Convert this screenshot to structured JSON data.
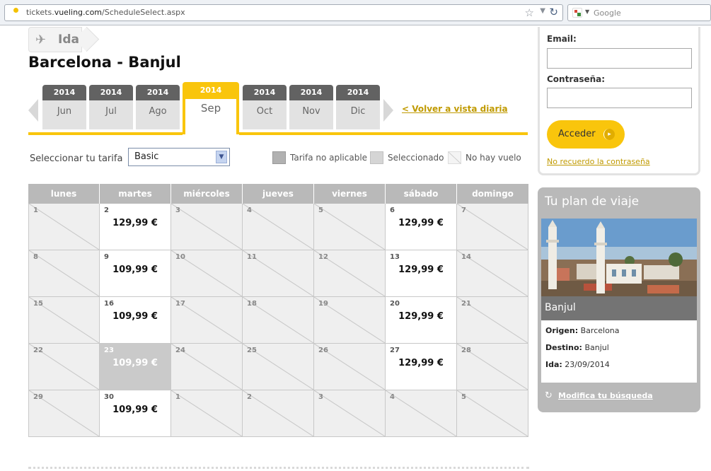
{
  "browser": {
    "url_prefix": "tickets.",
    "url_domain": "vueling.com",
    "url_path": "/ScheduleSelect.aspx",
    "search_placeholder": "Google"
  },
  "header": {
    "tab_label": "Ida",
    "route": "Barcelona - Banjul"
  },
  "months": [
    {
      "year": "2014",
      "label": "Jun"
    },
    {
      "year": "2014",
      "label": "Jul"
    },
    {
      "year": "2014",
      "label": "Ago"
    },
    {
      "year": "2014",
      "label": "Sep",
      "active": true
    },
    {
      "year": "2014",
      "label": "Oct"
    },
    {
      "year": "2014",
      "label": "Nov"
    },
    {
      "year": "2014",
      "label": "Dic"
    }
  ],
  "back_link": "< Volver a vista diaria",
  "tarifa": {
    "label": "Seleccionar tu tarifa",
    "value": "Basic"
  },
  "legend": {
    "not_applicable": "Tarifa no aplicable",
    "selected": "Seleccionado",
    "no_flight": "No hay vuelo"
  },
  "calendar": {
    "weekdays": [
      "lunes",
      "martes",
      "miércoles",
      "jueves",
      "viernes",
      "sábado",
      "domingo"
    ],
    "weeks": [
      [
        {
          "day": "1"
        },
        {
          "day": "2",
          "price": "129,99 €"
        },
        {
          "day": "3"
        },
        {
          "day": "4"
        },
        {
          "day": "5"
        },
        {
          "day": "6",
          "price": "129,99 €"
        },
        {
          "day": "7"
        }
      ],
      [
        {
          "day": "8"
        },
        {
          "day": "9",
          "price": "109,99 €"
        },
        {
          "day": "10"
        },
        {
          "day": "11"
        },
        {
          "day": "12"
        },
        {
          "day": "13",
          "price": "129,99 €"
        },
        {
          "day": "14"
        }
      ],
      [
        {
          "day": "15"
        },
        {
          "day": "16",
          "price": "109,99 €"
        },
        {
          "day": "17"
        },
        {
          "day": "18"
        },
        {
          "day": "19"
        },
        {
          "day": "20",
          "price": "129,99 €"
        },
        {
          "day": "21"
        }
      ],
      [
        {
          "day": "22"
        },
        {
          "day": "23",
          "price": "109,99 €",
          "selected": true
        },
        {
          "day": "24"
        },
        {
          "day": "25"
        },
        {
          "day": "26"
        },
        {
          "day": "27",
          "price": "129,99 €"
        },
        {
          "day": "28"
        }
      ],
      [
        {
          "day": "29"
        },
        {
          "day": "30",
          "price": "109,99 €"
        },
        {
          "day": "1"
        },
        {
          "day": "2"
        },
        {
          "day": "3"
        },
        {
          "day": "4"
        },
        {
          "day": "5"
        }
      ]
    ]
  },
  "login": {
    "email_label": "Email:",
    "password_label": "Contraseña:",
    "button": "Acceder",
    "forgot": "No recuerdo la contraseña"
  },
  "plan": {
    "title": "Tu plan de viaje",
    "city": "Banjul",
    "origin_label": "Origen:",
    "origin": "Barcelona",
    "dest_label": "Destino:",
    "dest": "Banjul",
    "date_label": "Ida:",
    "date": "23/09/2014",
    "modify_link": "Modifica tu búsqueda"
  },
  "colors": {
    "accent": "#f9c50c",
    "header_gray": "#b9b9b9"
  }
}
